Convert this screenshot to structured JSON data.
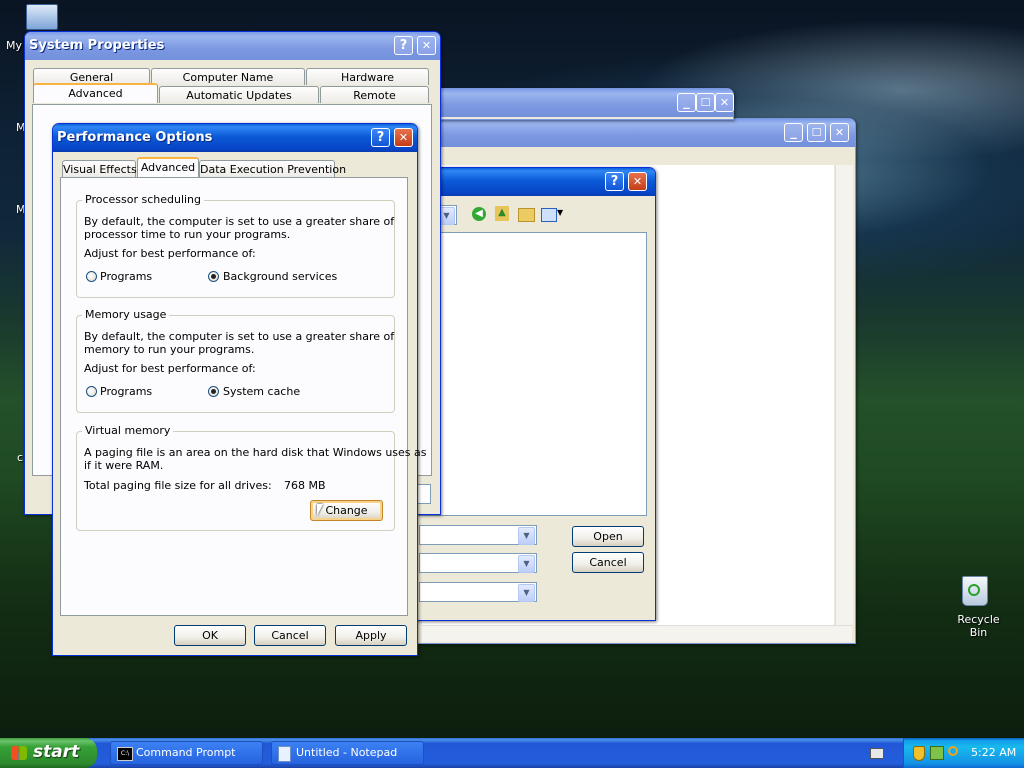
{
  "desktop": {
    "icon_my_computer": "My",
    "icon_recycle_bin": "Recycle Bin",
    "left_fragments": [
      "M",
      "M",
      "c"
    ]
  },
  "system_properties": {
    "title": "System Properties",
    "help_glyph": "?",
    "close_glyph": "✕",
    "tabs_row1": [
      "General",
      "Computer Name",
      "Hardware"
    ],
    "tabs_row2": [
      "Advanced",
      "Automatic Updates",
      "Remote"
    ],
    "active_tab": "Advanced"
  },
  "bg_window": {
    "min_glyph": "_",
    "max_glyph": "☐",
    "close_glyph": "✕"
  },
  "open_dialog": {
    "help_glyph": "?",
    "close_glyph": "✕",
    "open_label": "Open",
    "cancel_label": "Cancel"
  },
  "performance_options": {
    "title": "Performance Options",
    "help_glyph": "?",
    "close_glyph": "✕",
    "tabs": [
      "Visual Effects",
      "Advanced",
      "Data Execution Prevention"
    ],
    "active_tab": "Advanced",
    "processor": {
      "legend": "Processor scheduling",
      "desc1": "By default, the computer is set to use a greater share of",
      "desc2": "processor time to run your programs.",
      "adjust": "Adjust for best performance of:",
      "opt1": "Programs",
      "opt2": "Background services",
      "selected": "Background services"
    },
    "memory": {
      "legend": "Memory usage",
      "desc1": "By default, the computer is set to use a greater share of",
      "desc2": "memory to run your programs.",
      "adjust": "Adjust for best performance of:",
      "opt1": "Programs",
      "opt2": "System cache",
      "selected": "System cache"
    },
    "virtual": {
      "legend": "Virtual memory",
      "desc1": "A paging file is an area on the hard disk that Windows uses as",
      "desc2": "if it were RAM.",
      "total_label": "Total paging file size for all drives:",
      "total_value": "768 MB",
      "change_label": "Change"
    },
    "ok_label": "OK",
    "cancel_label": "Cancel",
    "apply_label": "Apply"
  },
  "taskbar": {
    "start_label": "start",
    "tasks": [
      "Command Prompt",
      "Untitled - Notepad"
    ],
    "clock": "5:22 AM"
  }
}
